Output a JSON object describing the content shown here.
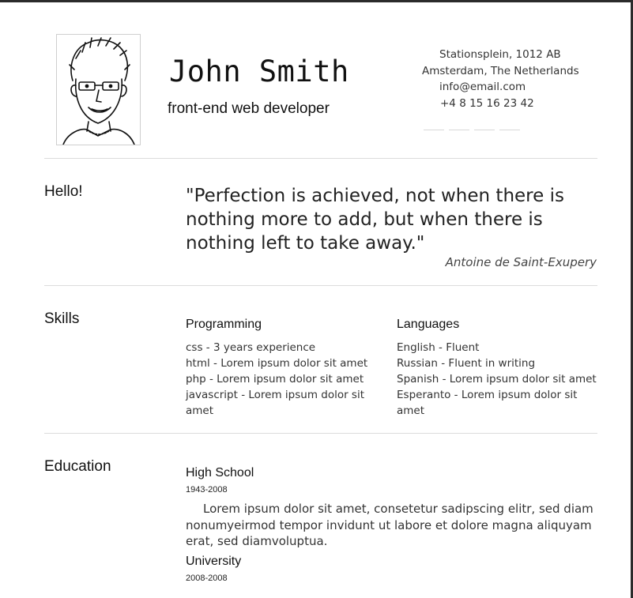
{
  "header": {
    "name": "John Smith",
    "title": "front-end web developer",
    "contact": {
      "address1": "Stationsplein, 1012 AB",
      "address2": "Amsterdam, The Netherlands",
      "email": "info@email.com",
      "phone": "+4 8 15 16 23 42"
    }
  },
  "hello": {
    "label": "Hello!",
    "quote": "\"Perfection is achieved, not when there is nothing more to add, but when there is nothing left to take away.\"",
    "author": "Antoine de Saint-Exupery"
  },
  "skills": {
    "label": "Skills",
    "programming": {
      "heading": "Programming",
      "items": [
        "css - 3 years experience",
        "html - Lorem ipsum dolor sit amet",
        "php - Lorem ipsum dolor sit amet",
        "javascript - Lorem ipsum dolor sit amet"
      ]
    },
    "languages": {
      "heading": "Languages",
      "items": [
        "English - Fluent",
        "Russian - Fluent in writing",
        "Spanish - Lorem ipsum dolor sit amet",
        "Esperanto - Lorem ipsum dolor sit amet"
      ]
    }
  },
  "education": {
    "label": "Education",
    "entries": [
      {
        "school": "High School",
        "dates": "1943-2008",
        "description": "Lorem ipsum dolor sit amet, consetetur sadipscing elitr, sed diam nonumyeirmod tempor invidunt ut labore et dolore magna aliquyam erat, sed diamvoluptua."
      },
      {
        "school": "University",
        "dates": "2008-2008"
      }
    ]
  },
  "colors": {
    "page_bg": "#ffffff",
    "frame_bg": "#2b2b2b",
    "rule": "#dcdcdc"
  }
}
